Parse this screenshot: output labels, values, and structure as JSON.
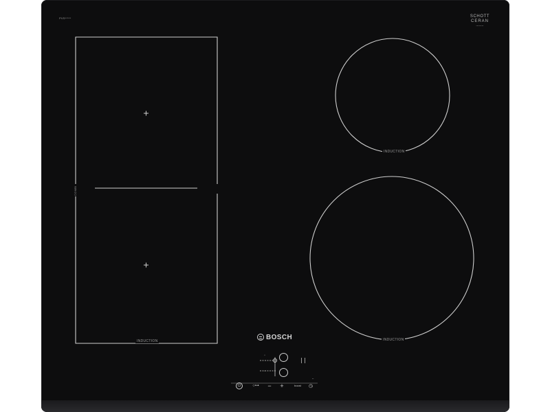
{
  "product": {
    "model_code": "PVS*****",
    "glass_brand_line1": "SCHOTT",
    "glass_brand_line2": "CERAN",
    "glass_small_print": "********",
    "brand_name": "BOSCH",
    "combi_zone_label": "COMBI"
  },
  "zones": {
    "flex_label": "INDUCTION",
    "top_right_label": "INDUCTION",
    "bottom_right_label": "INDUCTION"
  },
  "control_panel": {
    "minus_symbol": "−",
    "plus_symbol": "+",
    "boost_label": "boost",
    "lock_symbol": "○⊶",
    "power_symbol": "⏻",
    "timer_symbol": "◷",
    "small_label": "**",
    "ring_marker": "·"
  },
  "colors": {
    "glass": "#0d0d0e",
    "markings": "#cfcfcf",
    "text": "#9a9a9a"
  }
}
